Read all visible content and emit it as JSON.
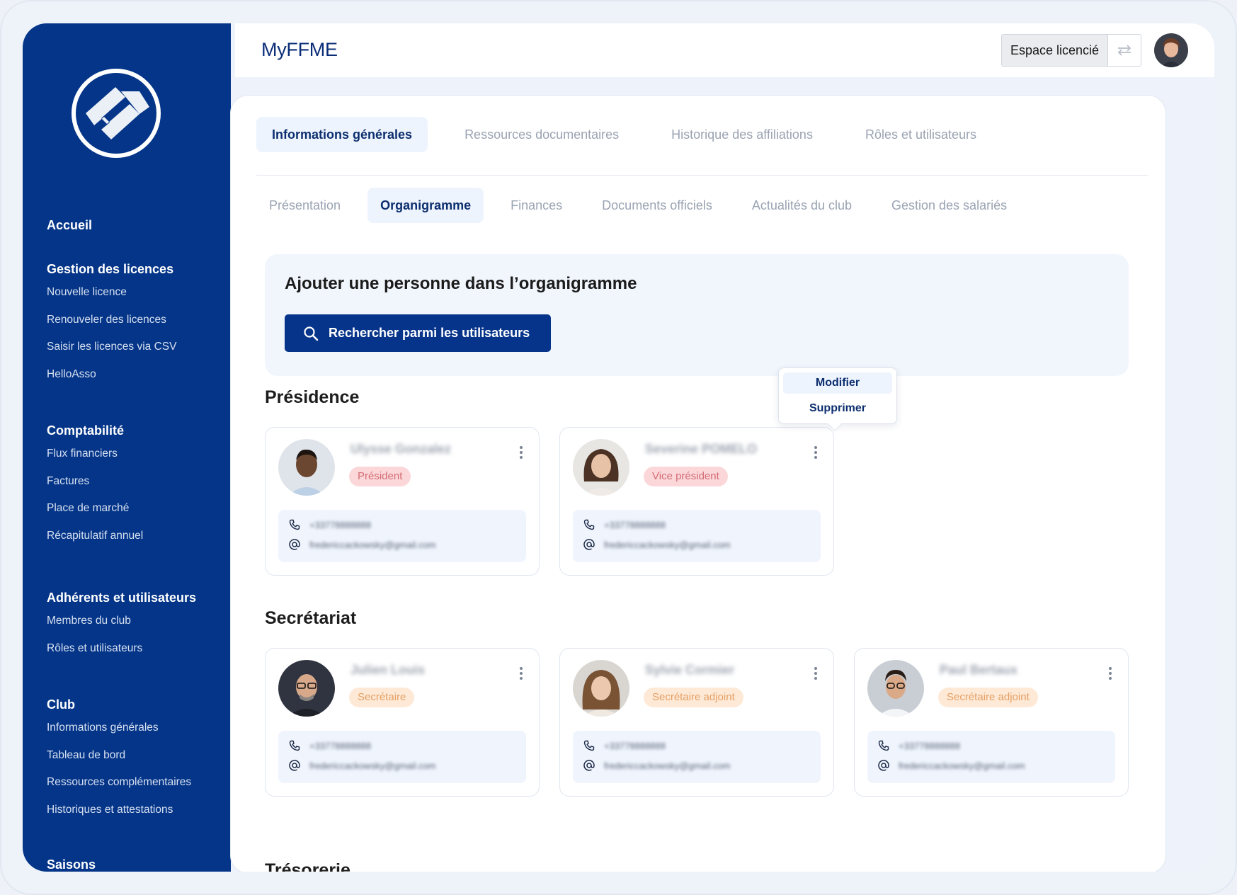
{
  "header": {
    "brand": "MyFFME",
    "space_label": "Espace licencié",
    "swap_icon": "swap-arrows-icon"
  },
  "sidebar": {
    "home": "Accueil",
    "groups": [
      {
        "title": "Gestion des licences",
        "items": [
          "Nouvelle licence",
          "Renouveler des licences",
          "Saisir les licences via CSV",
          "HelloAsso"
        ]
      },
      {
        "title": "Comptabilité",
        "items": [
          "Flux financiers",
          "Factures",
          "Place de marché",
          "Récapitulatif annuel"
        ]
      },
      {
        "title": "Adhérents et utilisateurs",
        "items": [
          "Membres du club",
          "Rôles et utilisateurs"
        ]
      },
      {
        "title": "Club",
        "items": [
          "Informations générales",
          "Tableau de bord",
          "Ressources complémentaires",
          "Historiques et attestations"
        ]
      },
      {
        "title": "Saisons",
        "items": []
      }
    ]
  },
  "tabs": [
    "Informations générales",
    "Ressources documentaires",
    "Historique des affiliations",
    "Rôles et utilisateurs"
  ],
  "active_tab": 0,
  "subtabs": [
    "Présentation",
    "Organigramme",
    "Finances",
    "Documents officiels",
    "Actualités du club",
    "Gestion des salariés"
  ],
  "active_subtab": 1,
  "add_panel": {
    "title": "Ajouter une personne dans l’organigramme",
    "search_button": "Rechercher parmi les utilisateurs"
  },
  "sections": [
    {
      "title": "Présidence",
      "members": [
        {
          "name": "Ulysse Gonzalez",
          "role": "Président",
          "role_color": "pink",
          "phone": "+33778888888",
          "email": "fredericcackowsky@gmail.com"
        },
        {
          "name": "Severine POMELO",
          "role": "Vice président",
          "role_color": "pink",
          "phone": "+33778888888",
          "email": "fredericcackowsky@gmail.com"
        }
      ]
    },
    {
      "title": "Secrétariat",
      "members": [
        {
          "name": "Julien Louis",
          "role": "Secrétaire",
          "role_color": "orange",
          "phone": "+33778888888",
          "email": "fredericcackowsky@gmail.com"
        },
        {
          "name": "Sylvie Cormier",
          "role": "Secrétaire adjoint",
          "role_color": "orange",
          "phone": "+33778888888",
          "email": "fredericcackowsky@gmail.com"
        },
        {
          "name": "Paul Bertaux",
          "role": "Secrétaire adjoint",
          "role_color": "orange",
          "phone": "+33778888888",
          "email": "fredericcackowsky@gmail.com"
        }
      ]
    },
    {
      "title": "Trésorerie",
      "members": []
    }
  ],
  "context_menu": {
    "edit": "Modifier",
    "delete": "Supprimer"
  },
  "colors": {
    "primary": "#043588",
    "tab_active_bg": "#eef4fd",
    "pink_badge": "#fbd7d9",
    "orange_badge": "#fde9d6"
  }
}
